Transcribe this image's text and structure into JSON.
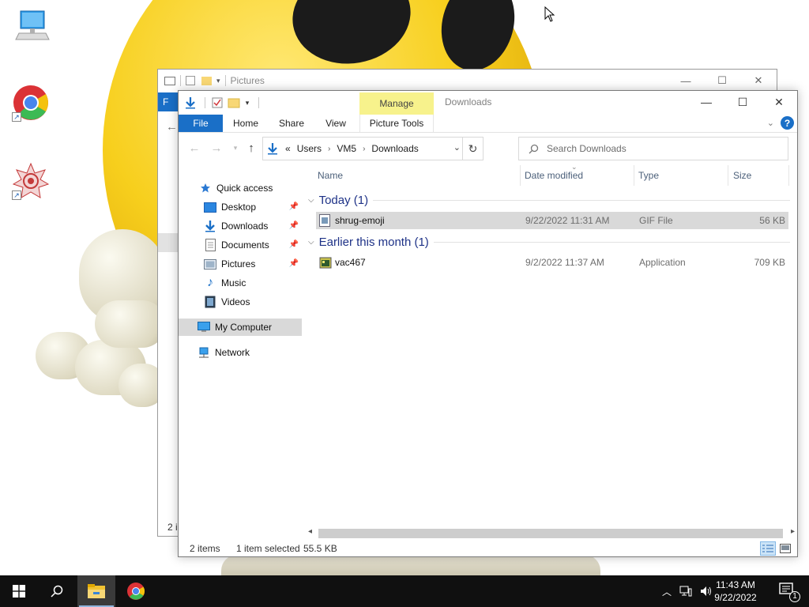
{
  "desktop": {
    "icons": [
      {
        "name": "this-pc"
      },
      {
        "name": "google-chrome"
      },
      {
        "name": "vac-app"
      }
    ]
  },
  "back_window": {
    "title": "Pictures",
    "file_tab_stub": "F",
    "status_stub": "2 i"
  },
  "window": {
    "title": "Downloads",
    "manage_tab": "Manage",
    "tabs": {
      "file": "File",
      "home": "Home",
      "share": "Share",
      "view": "View",
      "picture_tools": "Picture Tools"
    },
    "address": {
      "overflow": "«",
      "crumbs": [
        "Users",
        "VM5",
        "Downloads"
      ]
    },
    "search_placeholder": "Search Downloads",
    "nav": {
      "quick_access": "Quick access",
      "desktop": "Desktop",
      "downloads": "Downloads",
      "documents": "Documents",
      "pictures": "Pictures",
      "music": "Music",
      "videos": "Videos",
      "my_computer": "My Computer",
      "network": "Network"
    },
    "columns": {
      "name": "Name",
      "date": "Date modified",
      "type": "Type",
      "size": "Size"
    },
    "groups": [
      {
        "label": "Today (1)",
        "files": [
          {
            "name": "shrug-emoji",
            "date": "9/22/2022 11:31 AM",
            "type": "GIF File",
            "size": "56 KB",
            "selected": true
          }
        ]
      },
      {
        "label": "Earlier this month (1)",
        "files": [
          {
            "name": "vac467",
            "date": "9/2/2022 11:37 AM",
            "type": "Application",
            "size": "709 KB",
            "selected": false
          }
        ]
      }
    ],
    "status": {
      "items": "2 items",
      "selected": "1 item selected",
      "size": "55.5 KB"
    }
  },
  "taskbar": {
    "time": "11:43 AM",
    "date": "9/22/2022",
    "notification_count": "1"
  },
  "colors": {
    "accent": "#1a6fc7",
    "manage_tab": "#f7f28c",
    "group_header": "#1e3287",
    "taskbar": "#101010"
  }
}
